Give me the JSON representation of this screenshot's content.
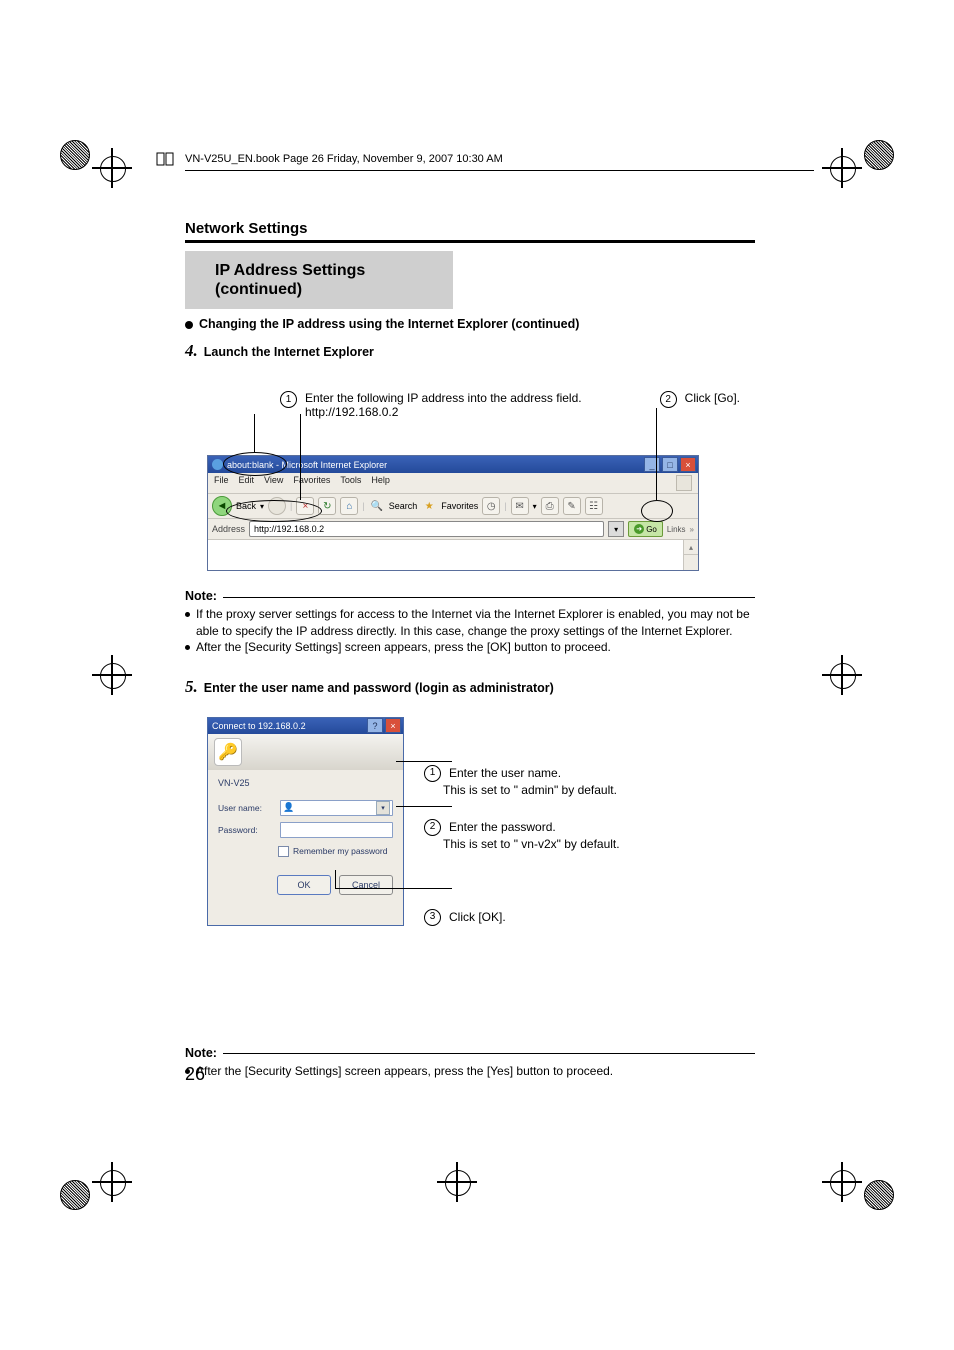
{
  "header_text": "VN-V25U_EN.book  Page 26  Friday, November 9, 2007  10:30 AM",
  "section_title": "Network Settings",
  "gray_title_l1": "IP Address Settings",
  "gray_title_l2": "(continued)",
  "bullet_main": "Changing the IP address using the Internet Explorer (continued)",
  "step4_num": "4.",
  "step4_text": "Launch the Internet Explorer",
  "callout1_num": "1",
  "callout1_line1": "Enter the following IP address into the address field.",
  "callout1_line2": "http://192.168.0.2",
  "callout2_num": "2",
  "callout2_text": "Click [Go].",
  "ie": {
    "title": "about:blank - Microsoft Internet Explorer",
    "menu": [
      "File",
      "Edit",
      "View",
      "Favorites",
      "Tools",
      "Help"
    ],
    "back": "Back",
    "search": "Search",
    "favorites": "Favorites",
    "addr_label": "Address",
    "addr_value": "http://192.168.0.2",
    "go": "Go",
    "links": "Links"
  },
  "note_label": "Note:",
  "note1_b1": "If the proxy server settings for access to the Internet via the Internet Explorer is enabled, you may not be able to specify the IP address directly. In this case, change the proxy settings of the Internet Explorer.",
  "note1_b2": "After the [Security Settings] screen appears, press the [OK] button to proceed.",
  "step5_num": "5.",
  "step5_text": "Enter the user name and password (login as administrator)",
  "login": {
    "title": "Connect to 192.168.0.2",
    "server": "VN-V25",
    "user_label": "User name:",
    "pass_label": "Password:",
    "remember": "Remember my password",
    "ok": "OK",
    "cancel": "Cancel"
  },
  "annot1_num": "1",
  "annot1_l1": "Enter the user name.",
  "annot1_l2": "This is set to \" admin\" by default.",
  "annot2_num": "2",
  "annot2_l1": "Enter the password.",
  "annot2_l2": "This is set to \" vn-v2x\" by default.",
  "annot3_num": "3",
  "annot3_text": "Click [OK].",
  "note2_b1": "After the [Security Settings] screen appears, press the [Yes] button to proceed.",
  "page_number": "26"
}
